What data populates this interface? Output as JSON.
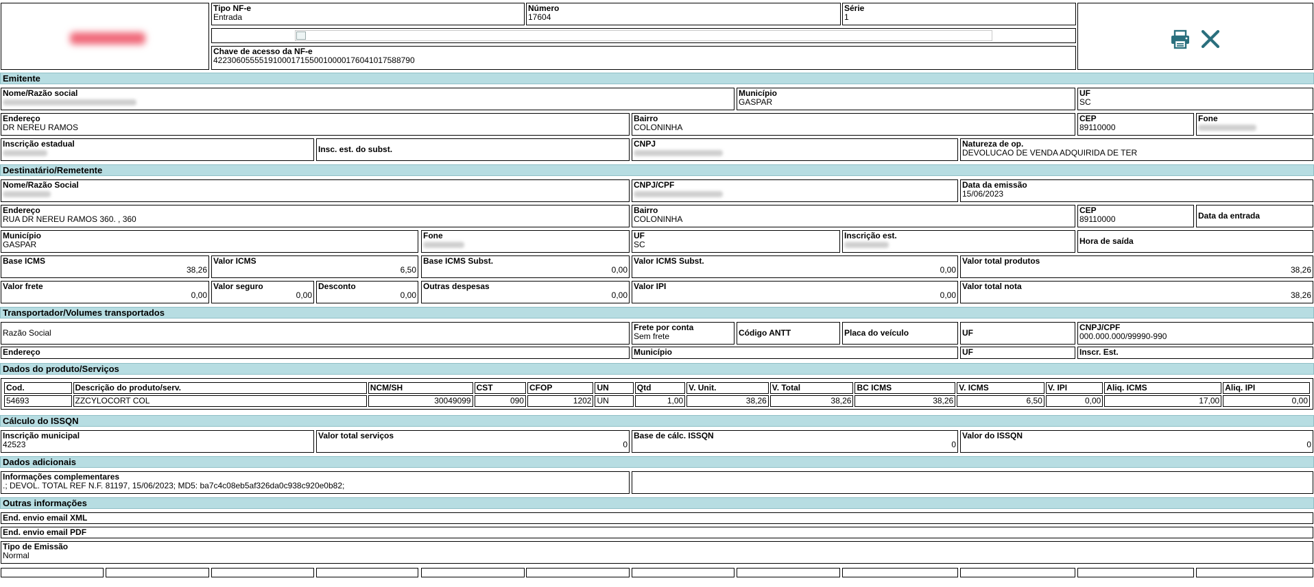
{
  "header": {
    "tipo_label": "Tipo NF-e",
    "tipo_value": "Entrada",
    "numero_label": "Número",
    "numero_value": "17604",
    "serie_label": "Série",
    "serie_value": "1",
    "chave_label": "Chave de acesso da NF-e",
    "chave_value": "42230605555191000171550010000176041017588790"
  },
  "icons": {
    "print": "printer-icon",
    "close": "close-icon",
    "accent": "#2a6f7d"
  },
  "sections": {
    "emitente": "Emitente",
    "destinatario": "Destinatário/Remetente",
    "transportador": "Transportador/Volumes transportados",
    "produtos": "Dados do produto/Serviços",
    "issqn": "Cálculo do ISSQN",
    "adicionais": "Dados adicionais",
    "outras": "Outras informações"
  },
  "emitente": {
    "nome_label": "Nome/Razão social",
    "municipio_label": "Município",
    "municipio_value": "GASPAR",
    "uf_label": "UF",
    "uf_value": "SC",
    "endereco_label": "Endereço",
    "endereco_value": "DR NEREU RAMOS",
    "bairro_label": "Bairro",
    "bairro_value": "COLONINHA",
    "cep_label": "CEP",
    "cep_value": "89110000",
    "fone_label": "Fone",
    "ie_label": "Inscrição estadual",
    "iest_label": "Insc. est. do subst.",
    "cnpj_label": "CNPJ",
    "natureza_label": "Natureza de op.",
    "natureza_value": "DEVOLUCAO DE VENDA ADQUIRIDA DE TER"
  },
  "destinatario": {
    "nome_label": "Nome/Razão Social",
    "cnpj_label": "CNPJ/CPF",
    "emissao_label": "Data da emissão",
    "emissao_value": "15/06/2023",
    "endereco_label": "Endereço",
    "endereco_value": "RUA DR NEREU RAMOS 360. , 360",
    "bairro_label": "Bairro",
    "bairro_value": "COLONINHA",
    "cep_label": "CEP",
    "cep_value": "89110000",
    "entrada_label": "Data da entrada",
    "municipio_label": "Município",
    "municipio_value": "GASPAR",
    "fone_label": "Fone",
    "uf_label": "UF",
    "uf_value": "SC",
    "ie_label": "Inscrição est.",
    "saida_label": "Hora de saída"
  },
  "totais": {
    "base_icms_label": "Base ICMS",
    "base_icms_value": "38,26",
    "valor_icms_label": "Valor ICMS",
    "valor_icms_value": "6,50",
    "base_st_label": "Base ICMS Subst.",
    "base_st_value": "0,00",
    "valor_st_label": "Valor ICMS Subst.",
    "valor_st_value": "0,00",
    "total_produtos_label": "Valor total produtos",
    "total_produtos_value": "38,26",
    "frete_label": "Valor frete",
    "frete_value": "0,00",
    "seguro_label": "Valor seguro",
    "seguro_value": "0,00",
    "desconto_label": "Desconto",
    "desconto_value": "0,00",
    "outras_label": "Outras despesas",
    "outras_value": "0,00",
    "ipi_label": "Valor IPI",
    "ipi_value": "0,00",
    "total_nota_label": "Valor total nota",
    "total_nota_value": "38,26"
  },
  "transportador": {
    "razao_label": "Razão Social",
    "frete_label": "Frete por conta",
    "frete_value": "Sem frete",
    "antt_label": "Código ANTT",
    "placa_label": "Placa do veículo",
    "uf_label": "UF",
    "cnpj_label": "CNPJ/CPF",
    "cnpj_value": "000.000.000/99990-990",
    "endereco_label": "Endereço",
    "municipio_label": "Município",
    "uf2_label": "UF",
    "ie_label": "Inscr. Est."
  },
  "produtos": {
    "headers": [
      "Cod.",
      "Descrição do produto/serv.",
      "NCM/SH",
      "CST",
      "CFOP",
      "UN",
      "Qtd",
      "V. Unit.",
      "V. Total",
      "BC ICMS",
      "V. ICMS",
      "V. IPI",
      "Aliq. ICMS",
      "Aliq. IPI"
    ],
    "rows": [
      [
        "54693",
        "ZZCYLOCORT COL",
        "30049099",
        "090",
        "1202",
        "UN",
        "1,00",
        "38,26",
        "38,26",
        "38,26",
        "6,50",
        "0,00",
        "17,00",
        "0,00"
      ]
    ]
  },
  "issqn": {
    "im_label": "Inscrição municipal",
    "im_value": "42523",
    "servicos_label": "Valor total serviços",
    "servicos_value": "0",
    "base_label": "Base de cálc. ISSQN",
    "base_value": "0",
    "valor_label": "Valor do ISSQN",
    "valor_value": "0"
  },
  "adicionais": {
    "info_label": "Informações complementares",
    "info_value": ".; DEVOL. TOTAL REF N.F. 81197, 15/06/2023; MD5: ba7c4c08eb5af326da0c938c920e0b82;"
  },
  "outras": {
    "xml_label": "End. envio email XML",
    "pdf_label": "End. envio email PDF",
    "emissao_label": "Tipo de Emissão",
    "emissao_value": "Normal"
  }
}
